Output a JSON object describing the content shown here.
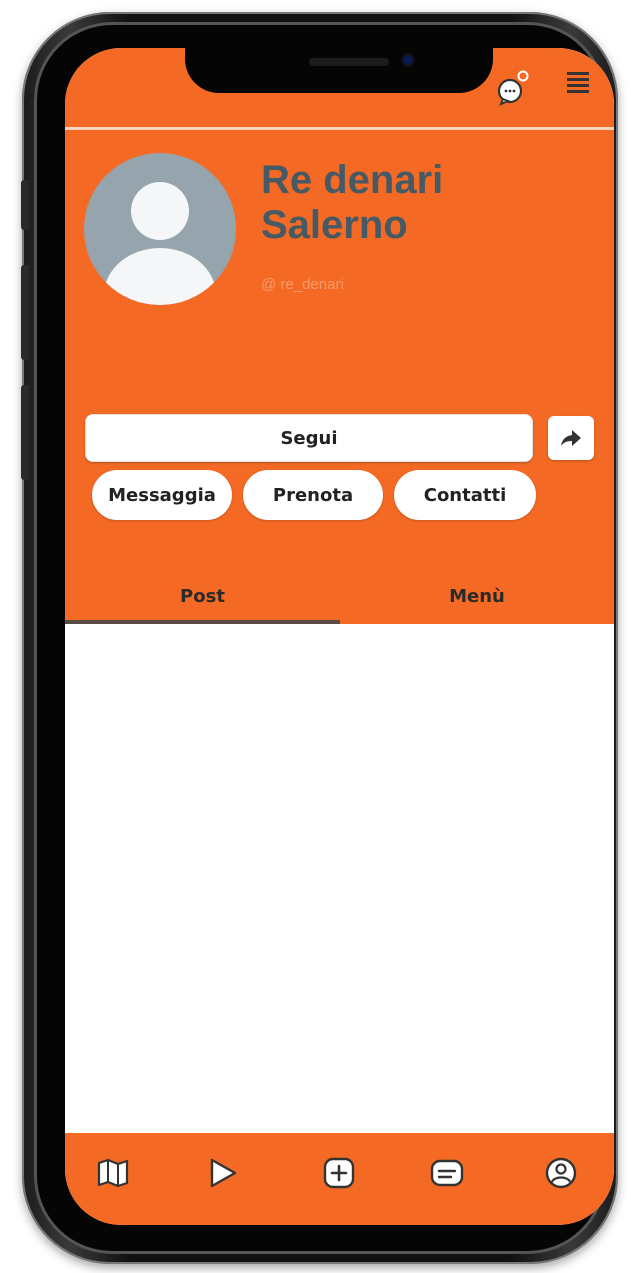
{
  "profile": {
    "name_line1": "Re denari",
    "name_line2": "Salerno",
    "handle": "@ re_denari"
  },
  "actions": {
    "follow_label": "Segui",
    "message_label": "Messaggia",
    "book_label": "Prenota",
    "contacts_label": "Contatti"
  },
  "tabs": [
    {
      "label": "Post",
      "active": true
    },
    {
      "label": "Menù",
      "active": false
    }
  ],
  "bottom_nav": {
    "icons": [
      "map-icon",
      "play-icon",
      "add-icon",
      "card-icon",
      "profile-icon"
    ]
  },
  "colors": {
    "accent": "#f46a24",
    "name_text": "#455a64",
    "handle_text": "#f39b6d",
    "avatar_bg": "#96a5ad"
  }
}
